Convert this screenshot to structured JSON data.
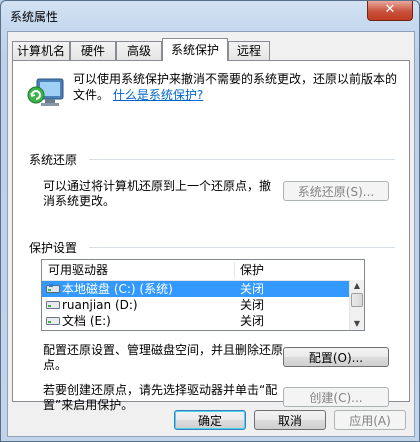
{
  "window": {
    "title": "系统属性",
    "close_glyph": "✕"
  },
  "tabs": [
    {
      "label": "计算机名"
    },
    {
      "label": "硬件"
    },
    {
      "label": "高级"
    },
    {
      "label": "系统保护"
    },
    {
      "label": "远程"
    }
  ],
  "intro": {
    "text": "可以使用系统保护来撤消不需要的系统更改，还原以前版本的文件。",
    "link": "什么是系统保护?"
  },
  "restore_group": {
    "title": "系统还原",
    "description": "可以通过将计算机还原到上一个还原点，撤消系统更改。",
    "button": "系统还原(S)..."
  },
  "protection_group": {
    "title": "保护设置",
    "columns": [
      "可用驱动器",
      "保护"
    ],
    "drives": [
      {
        "name": "本地磁盘 (C:) (系统)",
        "protection": "关闭",
        "selected": true
      },
      {
        "name": "ruanjian (D:)",
        "protection": "关闭",
        "selected": false
      },
      {
        "name": "文档 (E:)",
        "protection": "关闭",
        "selected": false
      }
    ],
    "configure_text": "配置还原设置、管理磁盘空间，并且删除还原点。",
    "configure_button": "配置(O)...",
    "create_text": "若要创建还原点，请先选择驱动器并单击“配置”来启用保护。",
    "create_button": "创建(C)..."
  },
  "dialog_buttons": {
    "ok": "确定",
    "cancel": "取消",
    "apply": "应用(A)"
  }
}
